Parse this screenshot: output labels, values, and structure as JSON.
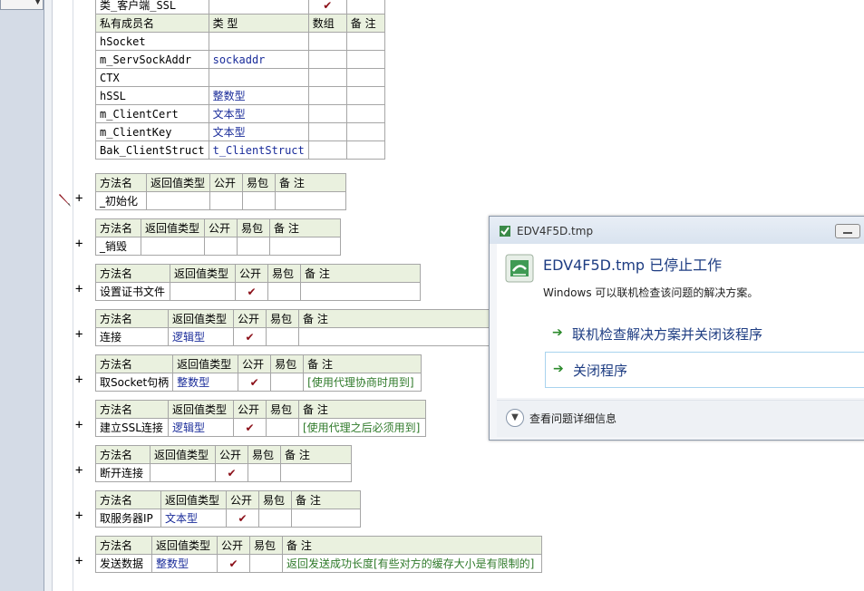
{
  "class_table": {
    "class_row": {
      "name": "类_客户端_SSL",
      "checked": true
    },
    "header": [
      "私有成员名",
      "类 型",
      "数组",
      "备 注"
    ],
    "members": [
      {
        "name": "hSocket",
        "type": ""
      },
      {
        "name": "m_ServSockAddr",
        "type": "sockaddr"
      },
      {
        "name": "CTX",
        "type": ""
      },
      {
        "name": "hSSL",
        "type": "整数型"
      },
      {
        "name": "m_ClientCert",
        "type": "文本型"
      },
      {
        "name": "m_ClientKey",
        "type": "文本型"
      },
      {
        "name": "Bak_ClientStruct",
        "type": "t_ClientStruct"
      }
    ]
  },
  "method_header": [
    "方法名",
    "返回值类型",
    "公开",
    "易包",
    "备 注"
  ],
  "methods": [
    {
      "name": "_初始化",
      "ret": "",
      "public": false,
      "note": ""
    },
    {
      "name": "_销毁",
      "ret": "",
      "public": false,
      "note": ""
    },
    {
      "name": "设置证书文件",
      "ret": "",
      "public": true,
      "note": ""
    },
    {
      "name": "连接",
      "ret": "逻辑型",
      "public": true,
      "note": ""
    },
    {
      "name": "取Socket句柄",
      "ret": "整数型",
      "public": true,
      "note": "[使用代理协商时用到]"
    },
    {
      "name": "建立SSL连接",
      "ret": "逻辑型",
      "public": true,
      "note": "[使用代理之后必须用到]"
    },
    {
      "name": "断开连接",
      "ret": "",
      "public": true,
      "note": ""
    },
    {
      "name": "取服务器IP",
      "ret": "文本型",
      "public": true,
      "note": ""
    },
    {
      "name": "发送数据",
      "ret": "整数型",
      "public": true,
      "note": "返回发送成功长度[有些对方的缓存大小是有限制的]"
    }
  ],
  "gutter_plus": "+",
  "check_mark": "✔",
  "dialog": {
    "title": "EDV4F5D.tmp",
    "heading": "EDV4F5D.tmp 已停止工作",
    "subtext": "Windows 可以联机检查该问题的解决方案。",
    "option1": "联机检查解决方案并关闭该程序",
    "option2": "关闭程序",
    "details": "查看问题详细信息"
  }
}
